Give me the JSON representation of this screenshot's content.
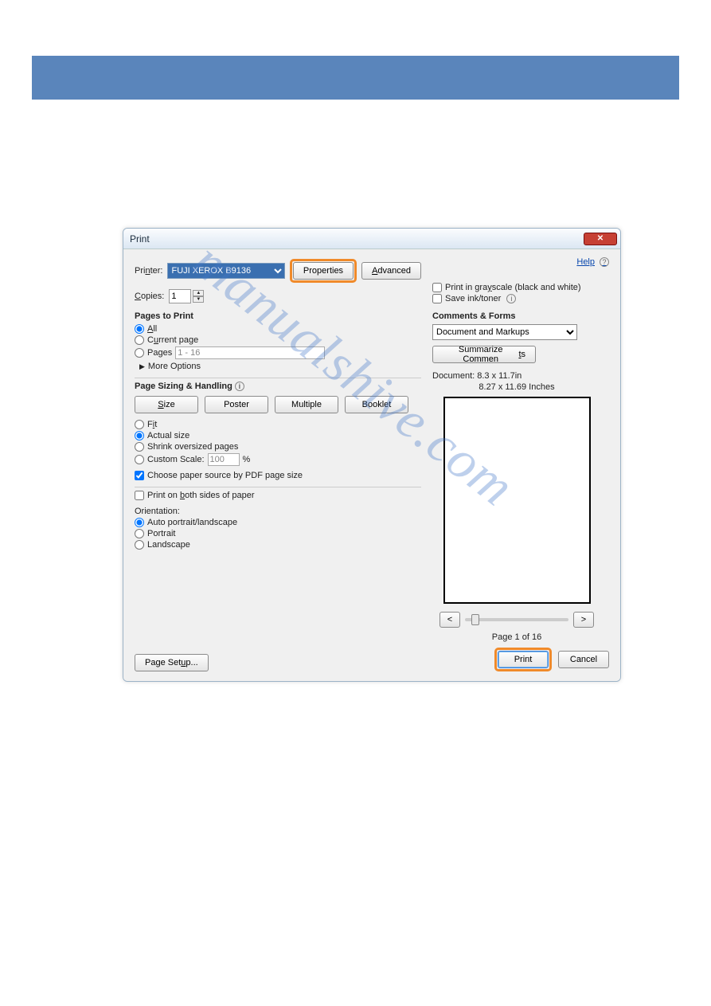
{
  "topbar": {},
  "dialog": {
    "title": "Print",
    "help_label": "Help",
    "printer_label": "Printer:",
    "printer_value": "FUJI XEROX B9136",
    "properties_label": "Properties",
    "advanced_label": "Advanced",
    "copies_label": "Copies:",
    "copies_value": "1",
    "grayscale_label": "Print in grayscale (black and white)",
    "saveink_label": "Save ink/toner",
    "pages_section": "Pages to Print",
    "pages": {
      "all": "All",
      "current": "Current page",
      "pages": "Pages",
      "pages_value": "1 - 16",
      "more": "More Options"
    },
    "sizing_section": "Page Sizing & Handling",
    "sizing_buttons": {
      "size": "Size",
      "poster": "Poster",
      "multiple": "Multiple",
      "booklet": "Booklet"
    },
    "sizing_opts": {
      "fit": "Fit",
      "actual": "Actual size",
      "shrink": "Shrink oversized pages",
      "custom": "Custom Scale:",
      "custom_val": "100",
      "pct": "%",
      "choose_source": "Choose paper source by PDF page size"
    },
    "duplex": "Print on both sides of paper",
    "orientation_label": "Orientation:",
    "orientation": {
      "auto": "Auto portrait/landscape",
      "portrait": "Portrait",
      "landscape": "Landscape"
    },
    "comments_section": "Comments & Forms",
    "comments_value": "Document and Markups",
    "summarize": "Summarize Comments",
    "doc_size": "Document: 8.3 x 11.7in",
    "paper_size": "8.27 x 11.69 Inches",
    "page_of": "Page 1 of 16",
    "page_setup": "Page Setup...",
    "print_btn": "Print",
    "cancel_btn": "Cancel"
  },
  "watermark": "manualshive.com"
}
